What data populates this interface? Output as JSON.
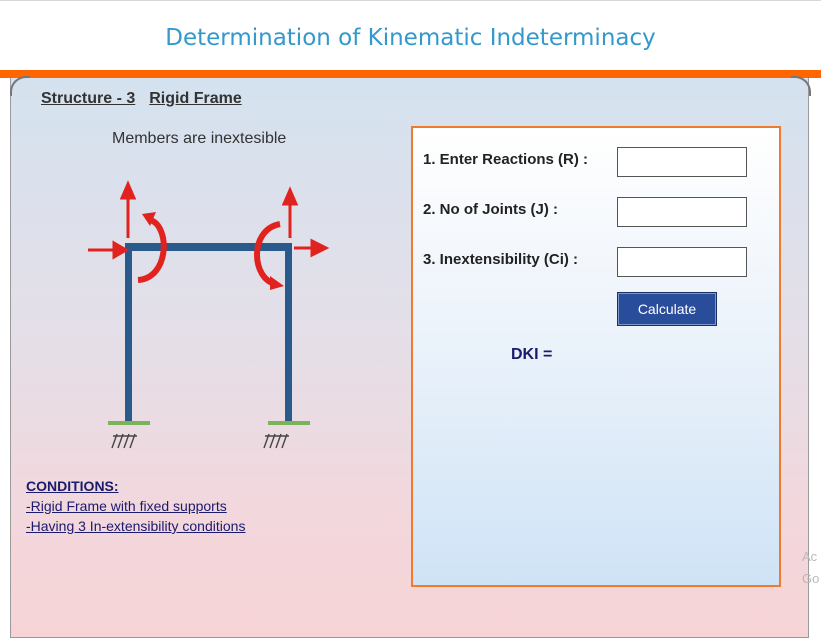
{
  "header": {
    "title": "Determination of Kinematic Indeterminacy"
  },
  "structure": {
    "number_label": "Structure - 3",
    "type_label": "Rigid Frame",
    "note": "Members are inextesible"
  },
  "conditions": {
    "heading": "CONDITIONS:",
    "items": [
      "-Rigid Frame with fixed supports",
      "-Having 3 In-extensibility conditions"
    ]
  },
  "form": {
    "reactions_label": "1. Enter Reactions (R) :",
    "joints_label": "2. No of Joints (J) :",
    "inextensibility_label": "3. Inextensibility (Ci) :",
    "reactions_value": "",
    "joints_value": "",
    "inextensibility_value": "",
    "calculate_label": "Calculate",
    "result_label": "DKI ="
  },
  "watermark": {
    "line1": "Ac",
    "line2": "Go"
  },
  "colors": {
    "title": "#3399cc",
    "accent_bar": "#ff6600",
    "frame": "#2a5a8c",
    "arrow": "#e0231e",
    "support": "#7bb35a",
    "button": "#2a4d9b"
  },
  "icons": [
    "rigid-frame-diagram",
    "force-arrow-icon",
    "moment-arrow-icon",
    "fixed-support-icon"
  ]
}
